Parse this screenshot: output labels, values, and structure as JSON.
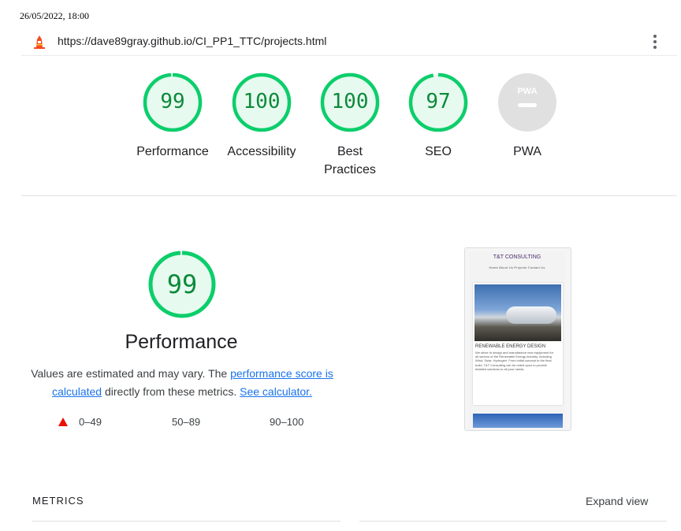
{
  "timestamp": "26/05/2022, 18:00",
  "url": "https://dave89gray.github.io/CI_PP1_TTC/projects.html",
  "icons": {
    "lighthouse": "lighthouse-icon",
    "menu": "kebab-menu-icon"
  },
  "colors": {
    "pass": "#0cce6b",
    "pass_text": "#0c8a3a",
    "fail": "#eb0f00",
    "link": "#1a73e8",
    "pwa_gray": "#e0e0e0"
  },
  "gauges": [
    {
      "score": "99",
      "label": "Performance",
      "fraction": 0.99
    },
    {
      "score": "100",
      "label": "Accessibility",
      "fraction": 1.0
    },
    {
      "score": "100",
      "label": "Best Practices",
      "fraction": 1.0
    },
    {
      "score": "97",
      "label": "SEO",
      "fraction": 0.97
    }
  ],
  "pwa": {
    "badge": "PWA",
    "label": "PWA"
  },
  "performance": {
    "score": "99",
    "fraction": 0.99,
    "title": "Performance",
    "desc_pre": "Values are estimated and may vary. The ",
    "desc_link": "performance score is calculated",
    "desc_mid": " directly from these metrics. ",
    "desc_link2": "See calculator."
  },
  "legend": [
    "0–49",
    "50–89",
    "90–100"
  ],
  "thumbnail": {
    "site_title": "T&T CONSULTING",
    "nav": "Home   About Us   Projects   Contact Us",
    "heading": "RENEWABLE ENERGY DESIGN",
    "body": "We strive to design and manufacture new equipment for all sectors of the Renewable Energy industry, including Wind, Solar, Hydrogen. From initial concept to the final build, T&T Consulting can be relied upon to provide detailed solutions to all your needs."
  },
  "metrics_label": "METRICS",
  "expand_view": "Expand view"
}
